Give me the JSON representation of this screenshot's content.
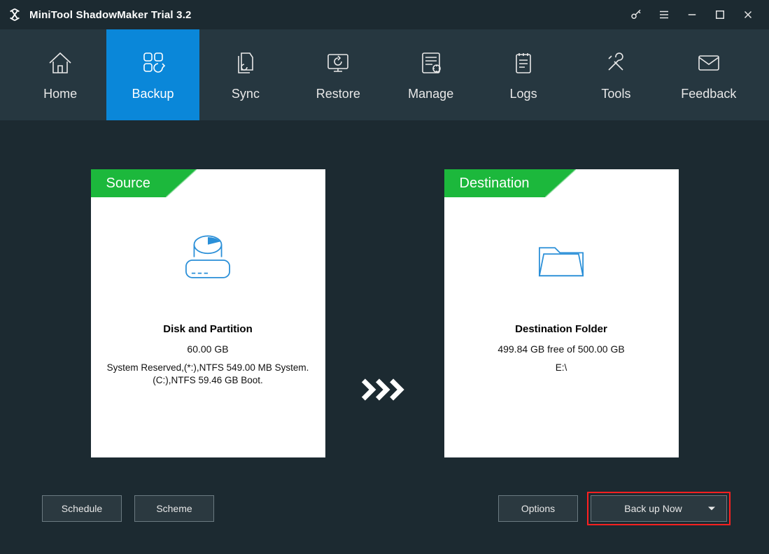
{
  "app": {
    "title": "MiniTool ShadowMaker Trial 3.2"
  },
  "nav": {
    "home": "Home",
    "backup": "Backup",
    "sync": "Sync",
    "restore": "Restore",
    "manage": "Manage",
    "logs": "Logs",
    "tools": "Tools",
    "feedback": "Feedback",
    "active": "backup"
  },
  "source": {
    "tab": "Source",
    "title": "Disk and Partition",
    "size": "60.00 GB",
    "detail": "System Reserved,(*:),NTFS 549.00 MB System. (C:),NTFS 59.46 GB Boot."
  },
  "destination": {
    "tab": "Destination",
    "title": "Destination Folder",
    "size": "499.84 GB free of 500.00 GB",
    "detail": "E:\\"
  },
  "buttons": {
    "schedule": "Schedule",
    "scheme": "Scheme",
    "options": "Options",
    "backupnow": "Back up Now"
  }
}
